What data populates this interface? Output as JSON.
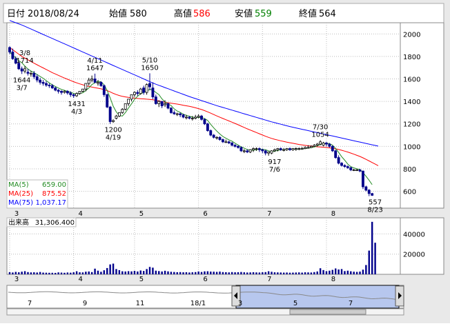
{
  "header": {
    "date_label": "日付",
    "date": "2018/08/24",
    "open_label": "始値",
    "open": "580",
    "high_label": "高値",
    "high": "586",
    "low_label": "安値",
    "low": "559",
    "close_label": "終値",
    "close": "564"
  },
  "ma_legend": [
    {
      "label": "MA(5)",
      "value": "659.00",
      "color": "#228b22"
    },
    {
      "label": "MA(25)",
      "value": "875.52",
      "color": "#ff0000"
    },
    {
      "label": "MA(75)",
      "value": "1,037.17",
      "color": "#0000ff"
    }
  ],
  "volume_label": "出来高",
  "volume_value": "31,306.400",
  "annotations": [
    {
      "text": [
        "3/8",
        "1714"
      ],
      "x": "3/8",
      "y": 1714,
      "pos": "above"
    },
    {
      "text": [
        "1644",
        "3/7"
      ],
      "x": "3/7",
      "y": 1644,
      "pos": "below"
    },
    {
      "text": [
        "4/11",
        "1647"
      ],
      "x": "4/11",
      "y": 1647,
      "pos": "above"
    },
    {
      "text": [
        "1431",
        "4/3"
      ],
      "x": "4/3",
      "y": 1431,
      "pos": "below"
    },
    {
      "text": [
        "5/10",
        "1650"
      ],
      "x": "5/10",
      "y": 1650,
      "pos": "above"
    },
    {
      "text": [
        "1200",
        "4/19"
      ],
      "x": "4/19",
      "y": 1200,
      "pos": "below"
    },
    {
      "text": [
        "7/30",
        "1054"
      ],
      "x": "7/30",
      "y": 1054,
      "pos": "above"
    },
    {
      "text": [
        "917",
        "7/6"
      ],
      "x": "7/6",
      "y": 917,
      "pos": "below"
    },
    {
      "text": [
        "557",
        "8/23"
      ],
      "x": "8/23",
      "y": 557,
      "pos": "below"
    }
  ],
  "navigator": {
    "labels": [
      "7",
      "9",
      "11",
      "18/1",
      "3",
      "5",
      "7"
    ]
  },
  "colors": {
    "up": "#000000",
    "down": "#00008b",
    "volume": "#00008b",
    "ma5": "#228b22",
    "ma25": "#ff0000",
    "ma75": "#0000ff",
    "selection": "#b7c7ee",
    "header_high": "#ff0000",
    "header_low": "#008000"
  },
  "chart_data": {
    "type": "candlestick",
    "price_axis": {
      "ylim": [
        450,
        2100
      ],
      "ticks": [
        600,
        800,
        1000,
        1200,
        1400,
        1600,
        1800,
        2000
      ]
    },
    "volume_axis": {
      "ylim": [
        0,
        56000
      ],
      "ticks": [
        20000,
        40000
      ]
    },
    "x_ticks": [
      "3",
      "4",
      "5",
      "6",
      "7",
      "8"
    ],
    "days": [
      "3/1",
      "3/2",
      "3/5",
      "3/6",
      "3/7",
      "3/8",
      "3/9",
      "3/12",
      "3/13",
      "3/14",
      "3/15",
      "3/16",
      "3/19",
      "3/20",
      "3/22",
      "3/23",
      "3/26",
      "3/27",
      "3/28",
      "3/29",
      "3/30",
      "4/2",
      "4/3",
      "4/4",
      "4/5",
      "4/6",
      "4/9",
      "4/10",
      "4/11",
      "4/12",
      "4/13",
      "4/16",
      "4/17",
      "4/18",
      "4/19",
      "4/20",
      "4/23",
      "4/24",
      "4/25",
      "4/26",
      "4/27",
      "5/1",
      "5/2",
      "5/7",
      "5/8",
      "5/9",
      "5/10",
      "5/11",
      "5/14",
      "5/15",
      "5/16",
      "5/17",
      "5/18",
      "5/21",
      "5/22",
      "5/23",
      "5/24",
      "5/25",
      "5/28",
      "5/29",
      "5/30",
      "5/31",
      "6/1",
      "6/4",
      "6/5",
      "6/6",
      "6/7",
      "6/8",
      "6/11",
      "6/12",
      "6/13",
      "6/14",
      "6/15",
      "6/18",
      "6/19",
      "6/20",
      "6/21",
      "6/22",
      "6/25",
      "6/26",
      "6/27",
      "6/28",
      "6/29",
      "7/2",
      "7/3",
      "7/4",
      "7/5",
      "7/6",
      "7/9",
      "7/10",
      "7/11",
      "7/12",
      "7/13",
      "7/17",
      "7/18",
      "7/19",
      "7/20",
      "7/23",
      "7/24",
      "7/25",
      "7/26",
      "7/27",
      "7/30",
      "7/31",
      "8/1",
      "8/2",
      "8/3",
      "8/6",
      "8/7",
      "8/8",
      "8/9",
      "8/10",
      "8/13",
      "8/14",
      "8/15",
      "8/16",
      "8/17",
      "8/20",
      "8/21",
      "8/22",
      "8/23",
      "8/24"
    ],
    "open": [
      1880,
      1840,
      1780,
      1740,
      1690,
      1670,
      1660,
      1650,
      1650,
      1620,
      1590,
      1570,
      1560,
      1545,
      1540,
      1520,
      1500,
      1490,
      1480,
      1490,
      1475,
      1460,
      1450,
      1470,
      1490,
      1510,
      1560,
      1590,
      1600,
      1560,
      1570,
      1540,
      1460,
      1350,
      1220,
      1250,
      1270,
      1300,
      1330,
      1380,
      1420,
      1460,
      1480,
      1470,
      1520,
      1480,
      1560,
      1520,
      1440,
      1380,
      1400,
      1370,
      1380,
      1340,
      1300,
      1290,
      1290,
      1280,
      1260,
      1260,
      1250,
      1250,
      1260,
      1270,
      1240,
      1200,
      1140,
      1100,
      1080,
      1080,
      1060,
      1040,
      1040,
      1030,
      1010,
      1000,
      990,
      960,
      960,
      950,
      970,
      980,
      980,
      970,
      960,
      940,
      940,
      960,
      970,
      980,
      970,
      970,
      980,
      970,
      980,
      980,
      980,
      980,
      990,
      990,
      1000,
      1010,
      1020,
      1010,
      1030,
      1020,
      1000,
      960,
      900,
      850,
      830,
      820,
      810,
      790,
      790,
      790,
      780,
      640,
      610,
      580
    ],
    "high": [
      1890,
      1870,
      1800,
      1760,
      1710,
      1714,
      1690,
      1670,
      1670,
      1640,
      1610,
      1590,
      1580,
      1560,
      1555,
      1530,
      1510,
      1500,
      1500,
      1500,
      1490,
      1470,
      1480,
      1490,
      1510,
      1560,
      1610,
      1630,
      1647,
      1590,
      1580,
      1550,
      1470,
      1360,
      1240,
      1280,
      1300,
      1340,
      1380,
      1420,
      1460,
      1490,
      1500,
      1520,
      1540,
      1560,
      1650,
      1570,
      1460,
      1410,
      1400,
      1410,
      1390,
      1350,
      1320,
      1300,
      1300,
      1290,
      1280,
      1270,
      1270,
      1280,
      1285,
      1280,
      1250,
      1210,
      1150,
      1110,
      1090,
      1090,
      1070,
      1060,
      1050,
      1040,
      1020,
      1010,
      1000,
      975,
      975,
      975,
      990,
      990,
      990,
      980,
      970,
      950,
      965,
      980,
      985,
      990,
      985,
      985,
      990,
      985,
      990,
      990,
      995,
      1000,
      1010,
      1010,
      1020,
      1030,
      1054,
      1040,
      1040,
      1030,
      1010,
      970,
      920,
      860,
      840,
      830,
      820,
      800,
      800,
      800,
      785,
      650,
      620,
      586
    ],
    "low": [
      1820,
      1770,
      1730,
      1680,
      1644,
      1650,
      1630,
      1620,
      1600,
      1570,
      1550,
      1540,
      1530,
      1520,
      1510,
      1490,
      1470,
      1460,
      1470,
      1460,
      1440,
      1431,
      1440,
      1460,
      1480,
      1490,
      1540,
      1570,
      1560,
      1540,
      1530,
      1440,
      1340,
      1200,
      1210,
      1240,
      1260,
      1290,
      1320,
      1360,
      1400,
      1440,
      1450,
      1460,
      1460,
      1460,
      1500,
      1420,
      1370,
      1350,
      1340,
      1350,
      1330,
      1290,
      1280,
      1270,
      1260,
      1250,
      1240,
      1240,
      1230,
      1240,
      1250,
      1230,
      1190,
      1130,
      1090,
      1070,
      1060,
      1050,
      1030,
      1030,
      1020,
      1000,
      990,
      980,
      950,
      940,
      940,
      940,
      950,
      960,
      950,
      940,
      920,
      917,
      930,
      950,
      955,
      960,
      955,
      960,
      960,
      960,
      960,
      965,
      970,
      975,
      980,
      985,
      995,
      1000,
      1010,
      1000,
      1000,
      990,
      950,
      890,
      840,
      820,
      810,
      800,
      780,
      780,
      780,
      770,
      620,
      600,
      557,
      559
    ],
    "close": [
      1840,
      1780,
      1740,
      1690,
      1670,
      1690,
      1650,
      1650,
      1620,
      1590,
      1570,
      1560,
      1545,
      1540,
      1520,
      1500,
      1490,
      1480,
      1490,
      1475,
      1460,
      1450,
      1470,
      1490,
      1510,
      1560,
      1590,
      1600,
      1570,
      1570,
      1540,
      1460,
      1350,
      1220,
      1230,
      1270,
      1300,
      1330,
      1380,
      1420,
      1460,
      1480,
      1470,
      1510,
      1480,
      1550,
      1530,
      1440,
      1380,
      1400,
      1360,
      1380,
      1340,
      1300,
      1290,
      1290,
      1280,
      1260,
      1260,
      1250,
      1250,
      1260,
      1270,
      1240,
      1200,
      1140,
      1100,
      1080,
      1080,
      1060,
      1040,
      1040,
      1030,
      1010,
      1000,
      990,
      960,
      960,
      950,
      970,
      980,
      980,
      970,
      960,
      940,
      950,
      960,
      970,
      980,
      970,
      970,
      980,
      970,
      980,
      980,
      980,
      980,
      990,
      990,
      1000,
      1010,
      1020,
      1040,
      1030,
      1020,
      1000,
      960,
      900,
      850,
      830,
      820,
      810,
      790,
      790,
      790,
      780,
      640,
      610,
      580,
      564
    ],
    "volume": [
      2100,
      1800,
      2400,
      2000,
      2600,
      3100,
      2200,
      1900,
      2000,
      1800,
      2300,
      1700,
      1600,
      1500,
      1500,
      1400,
      1900,
      1700,
      1500,
      1800,
      1600,
      2000,
      3000,
      2000,
      1900,
      2600,
      2800,
      2200,
      5600,
      3600,
      2500,
      4000,
      6200,
      9800,
      10600,
      5200,
      4100,
      3000,
      2800,
      3100,
      2900,
      3400,
      2800,
      3800,
      3300,
      5200,
      7300,
      6600,
      3600,
      3200,
      2800,
      3500,
      2900,
      2500,
      2300,
      2100,
      2200,
      2000,
      2100,
      1800,
      2000,
      2200,
      2800,
      2300,
      2900,
      3000,
      2700,
      2600,
      2400,
      2700,
      2200,
      2100,
      1900,
      2200,
      2000,
      2100,
      2300,
      2000,
      1800,
      1900,
      2100,
      1900,
      1800,
      2000,
      2200,
      3000,
      2500,
      2000,
      1900,
      1800,
      1700,
      1800,
      1600,
      1700,
      1800,
      1900,
      1700,
      2000,
      1900,
      1800,
      2200,
      2800,
      6000,
      4200,
      3100,
      3600,
      4400,
      5800,
      4800,
      5200,
      3200,
      3600,
      3000,
      2600,
      2400,
      2700,
      4600,
      9200,
      23500,
      52000,
      31306
    ],
    "ma5": [
      1840,
      1810,
      1787,
      1762,
      1744,
      1714,
      1688,
      1670,
      1656,
      1640,
      1622,
      1606,
      1585,
      1565,
      1547,
      1533,
      1519,
      1507,
      1498,
      1489,
      1481,
      1471,
      1467,
      1469,
      1476,
      1496,
      1520,
      1550,
      1566,
      1580,
      1574,
      1548,
      1498,
      1432,
      1358,
      1306,
      1274,
      1270,
      1301,
      1340,
      1378,
      1418,
      1446,
      1468,
      1480,
      1492,
      1507,
      1502,
      1480,
      1461,
      1422,
      1396,
      1376,
      1364,
      1334,
      1314,
      1302,
      1286,
      1276,
      1268,
      1260,
      1256,
      1258,
      1256,
      1248,
      1230,
      1196,
      1164,
      1136,
      1110,
      1088,
      1072,
      1058,
      1046,
      1028,
      1012,
      996,
      984,
      972,
      966,
      966,
      970,
      974,
      974,
      970,
      960,
      954,
      956,
      964,
      970,
      970,
      974,
      974,
      974,
      974,
      976,
      978,
      980,
      984,
      988,
      994,
      1004,
      1016,
      1024,
      1028,
      1024,
      1010,
      982,
      946,
      908,
      876,
      842,
      820,
      808,
      800,
      794,
      766,
      734,
      698,
      659
    ],
    "ma25": [
      1880,
      1860,
      1840,
      1820,
      1800,
      1785,
      1770,
      1755,
      1740,
      1726,
      1712,
      1698,
      1684,
      1670,
      1656,
      1644,
      1632,
      1620,
      1608,
      1597,
      1586,
      1575,
      1565,
      1556,
      1548,
      1540,
      1533,
      1527,
      1522,
      1517,
      1512,
      1505,
      1496,
      1485,
      1472,
      1461,
      1452,
      1445,
      1440,
      1436,
      1432,
      1429,
      1426,
      1424,
      1422,
      1420,
      1418,
      1414,
      1410,
      1404,
      1398,
      1393,
      1388,
      1384,
      1380,
      1376,
      1371,
      1366,
      1361,
      1356,
      1350,
      1343,
      1336,
      1328,
      1318,
      1307,
      1295,
      1283,
      1271,
      1259,
      1248,
      1237,
      1226,
      1215,
      1204,
      1192,
      1180,
      1168,
      1156,
      1145,
      1134,
      1123,
      1112,
      1101,
      1090,
      1080,
      1071,
      1063,
      1056,
      1049,
      1043,
      1037,
      1032,
      1027,
      1022,
      1017,
      1013,
      1009,
      1005,
      1002,
      999,
      996,
      994,
      992,
      990,
      987,
      983,
      978,
      972,
      965,
      957,
      949,
      940,
      930,
      920,
      910,
      898,
      884,
      870,
      856,
      842,
      828
    ],
    "ma75": [
      2120,
      2110,
      2100,
      2090,
      2080,
      2068,
      2056,
      2044,
      2032,
      2020,
      2008,
      1996,
      1984,
      1972,
      1960,
      1948,
      1936,
      1924,
      1912,
      1900,
      1888,
      1876,
      1864,
      1852,
      1840,
      1828,
      1816,
      1804,
      1792,
      1780,
      1768,
      1756,
      1744,
      1732,
      1720,
      1708,
      1696,
      1684,
      1672,
      1660,
      1648,
      1636,
      1624,
      1612,
      1600,
      1588,
      1576,
      1564,
      1553,
      1543,
      1533,
      1523,
      1513,
      1503,
      1493,
      1483,
      1473,
      1463,
      1453,
      1443,
      1434,
      1425,
      1416,
      1407,
      1398,
      1389,
      1380,
      1371,
      1362,
      1354,
      1346,
      1338,
      1330,
      1322,
      1314,
      1306,
      1298,
      1290,
      1282,
      1274,
      1266,
      1258,
      1250,
      1242,
      1234,
      1226,
      1218,
      1211,
      1204,
      1197,
      1190,
      1183,
      1176,
      1170,
      1164,
      1158,
      1152,
      1146,
      1140,
      1134,
      1128,
      1122,
      1116,
      1110,
      1104,
      1098,
      1092,
      1086,
      1080,
      1074,
      1068,
      1062,
      1056,
      1050,
      1044,
      1038,
      1032,
      1026,
      1020,
      1014,
      1008,
      1002
    ]
  }
}
